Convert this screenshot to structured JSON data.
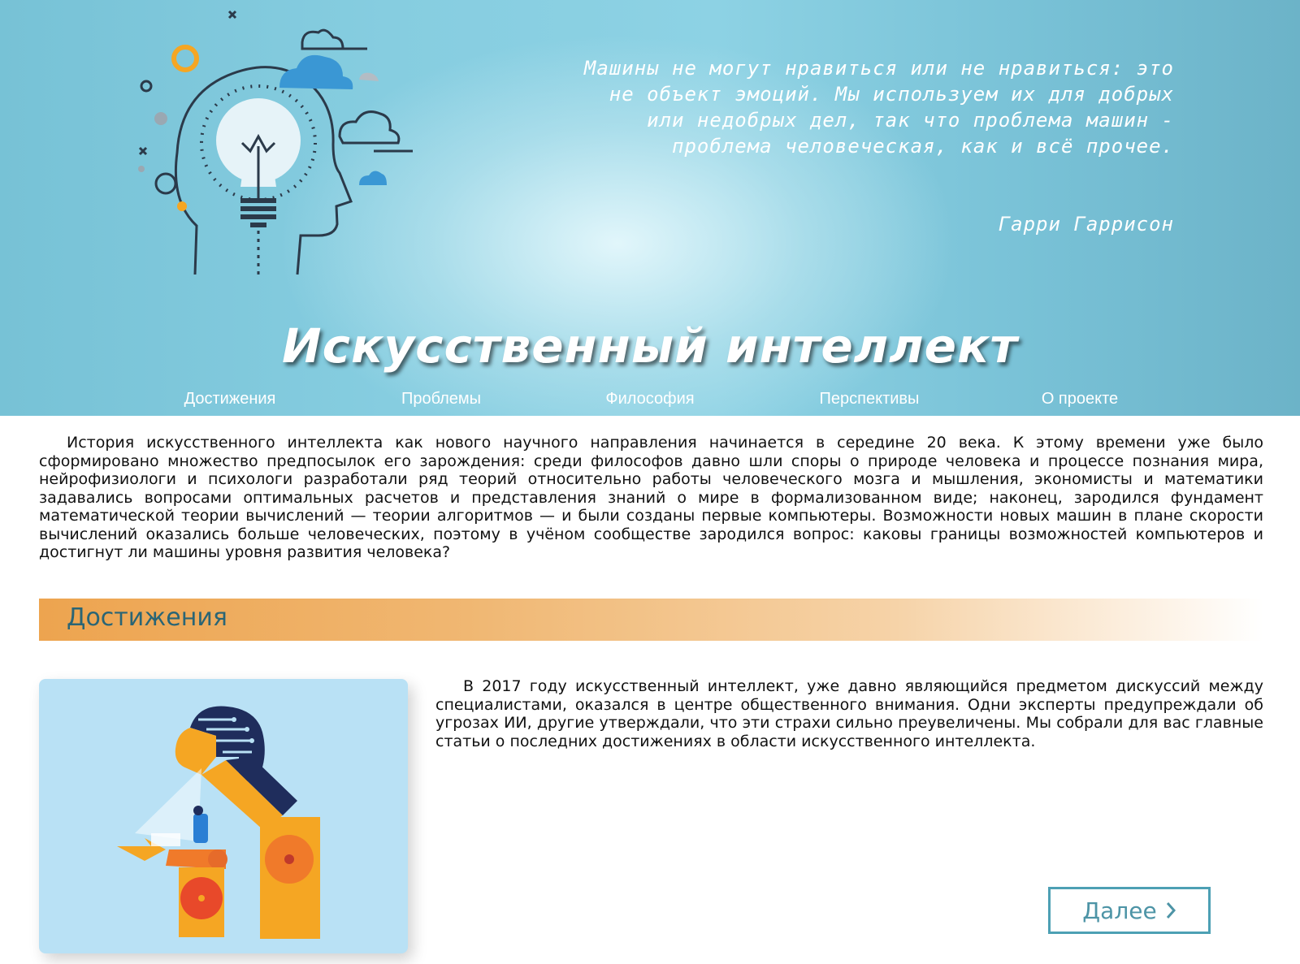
{
  "header": {
    "quote": "Машины не могут нравиться или не нравиться: это не объект эмоций. Мы используем их для добрых или недобрых дел, так что проблема машин - проблема человеческая, как и всё прочее.",
    "quote_author": "Гарри Гаррисон",
    "site_title": "Искусственный интеллект"
  },
  "nav": [
    {
      "label": "Достижения"
    },
    {
      "label": "Проблемы"
    },
    {
      "label": "Философия"
    },
    {
      "label": "Перспективы"
    },
    {
      "label": "О проекте"
    }
  ],
  "intro": "История искусственного интеллекта как нового научного направления начинается в середине 20 века. К этому времени уже было сформировано множество предпосылок его зарождения: среди философов давно шли споры о природе человека и процессе познания мира, нейрофизиологи и психологи разработали ряд теорий относительно работы человеческого мозга и мышления, экономисты и математики задавались вопросами оптимальных расчетов и представления знаний о мире в формализованном виде; наконец, зародился фундамент математической теории вычислений — теории алгоритмов — и были созданы первые компьютеры. Возможности новых машин в плане скорости вычислений оказались больше человеческих, поэтому в учёном сообществе зародился вопрос: каковы границы возможностей компьютеров и достигнут ли машины уровня развития человека?",
  "section": {
    "title": "Достижения",
    "article_text": "В 2017 году искусственный интеллект, уже давно являющийся предметом дискуссий между специалистами, оказался в центре общественного внимания. Одни эксперты предупреждали об угрозах ИИ, другие утверждали, что эти страхи сильно преувеличены. Мы собрали для вас главные статьи о последних достижениях в области искусственного интеллекта.",
    "more_label": "Далее",
    "more_icon": "chevron-right-icon"
  },
  "colors": {
    "header_blue": "#86cde0",
    "section_orange": "#eda44f",
    "accent_teal": "#4da0b4",
    "section_title": "#2a6575"
  }
}
